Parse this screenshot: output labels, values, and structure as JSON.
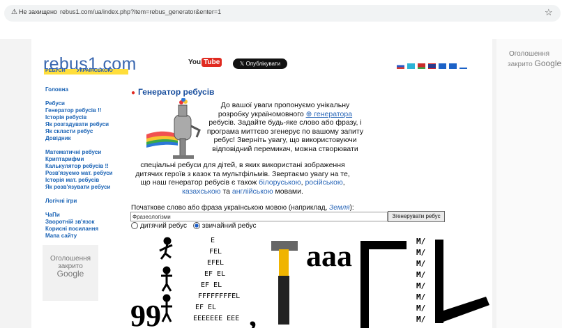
{
  "browser": {
    "security_warning": "Не захищено",
    "url": "rebus1.com/ua/index.php?item=rebus_generator&enter=1",
    "star_icon": "star-icon"
  },
  "ads": {
    "right_line1": "Оголошення",
    "right_line2": "закрито",
    "right_brand": "Google",
    "left_line1": "Оголошення",
    "left_line2": "закрито",
    "left_brand": "Google"
  },
  "header": {
    "logo_title": "rebus1.com",
    "logo_sub1": "РЕБУСИ",
    "logo_sub2": "УКРАЇНСЬКОЮ",
    "youtube": "You",
    "youtube_tube": "Tube",
    "x_button": "𝕏 Опублікувати"
  },
  "nav": {
    "items": [
      "Головна",
      "",
      "Ребуси",
      "Генератор ребусів !!",
      "Історія ребусів",
      "Як розгадувати ребуси",
      "Як скласти ребус",
      "Довідник",
      "",
      "Математичні ребуси",
      "Криптарифми",
      "Калькулятор ребусів !!",
      "Розв'язуємо мат. ребуси",
      "Історія мат. ребусів",
      "Як розв'язувати ребуси",
      "",
      "Логічні ігри",
      "",
      "ЧаПи",
      "Зворотній зв'язок",
      "Корисні посилання",
      "Мапа сайту"
    ]
  },
  "main": {
    "title": "Генератор ребусів",
    "intro_a": "До вашої уваги пропонуємо унікальну розробку україномовного ",
    "intro_link": "генератора",
    "intro_b": " ребусів. Задайте будь-яке слово або фразу, і програма миттєво згенерує по вашому запиту ребус! Зверніть увагу, що використовуючи відповідний перемикач, можна створювати",
    "intro2_a": "спеціальні ребуси для дітей, в яких використані зображення дитячих героїв з казок та мультфільмів. Звертаємо увагу на те, що наш генератор ребусів є також ",
    "lang1": "білоруською",
    "sep1": ", ",
    "lang2": "російською",
    "sep2": ", ",
    "lang3": "казахською",
    "sep3": " та ",
    "lang4": "англійською",
    "intro2_end": " мовами."
  },
  "form": {
    "label": "Початкове слово або фраза українською мовою (наприклад, ",
    "example": "Земля",
    "label_end": "):",
    "input_value": "Фразеологізми",
    "generate_button": "Згенерувати ребус",
    "radio_kids": "дитячий ребус",
    "radio_normal": "звичайний ребус",
    "selected": "звичайний ребус"
  },
  "colors": {
    "link": "#2a67b8",
    "nav": "#1a63b5",
    "title": "#1a4f9e",
    "logo_bar": "#ffde3b",
    "accent_red": "#e12a22"
  }
}
